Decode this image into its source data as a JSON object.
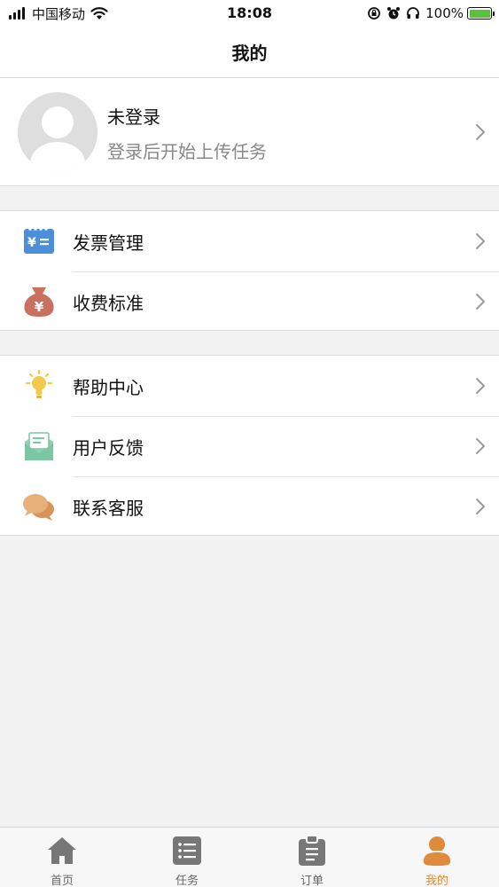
{
  "status_bar": {
    "carrier": "中国移动",
    "time": "18:08",
    "battery": "100%",
    "battery_level": 1.0
  },
  "nav": {
    "title": "我的"
  },
  "profile": {
    "name": "未登录",
    "subtitle": "登录后开始上传任务"
  },
  "menu": {
    "group1": [
      {
        "label": "发票管理",
        "icon": "invoice-icon",
        "color": "#4a90d9"
      },
      {
        "label": "收费标准",
        "icon": "money-bag-icon",
        "color": "#c9705e"
      }
    ],
    "group2": [
      {
        "label": "帮助中心",
        "icon": "lightbulb-icon",
        "color": "#f2c94c"
      },
      {
        "label": "用户反馈",
        "icon": "feedback-mail-icon",
        "color": "#7cc7a3"
      },
      {
        "label": "联系客服",
        "icon": "chat-bubbles-icon",
        "color": "#e0a86a"
      }
    ]
  },
  "tabs": [
    {
      "label": "首页",
      "icon": "home-icon"
    },
    {
      "label": "任务",
      "icon": "task-list-icon"
    },
    {
      "label": "订单",
      "icon": "clipboard-icon"
    },
    {
      "label": "我的",
      "icon": "profile-icon",
      "active": true
    }
  ],
  "colors": {
    "accent": "#e08a3c",
    "inactive_tab": "#777777",
    "background": "#f2f2f2"
  }
}
